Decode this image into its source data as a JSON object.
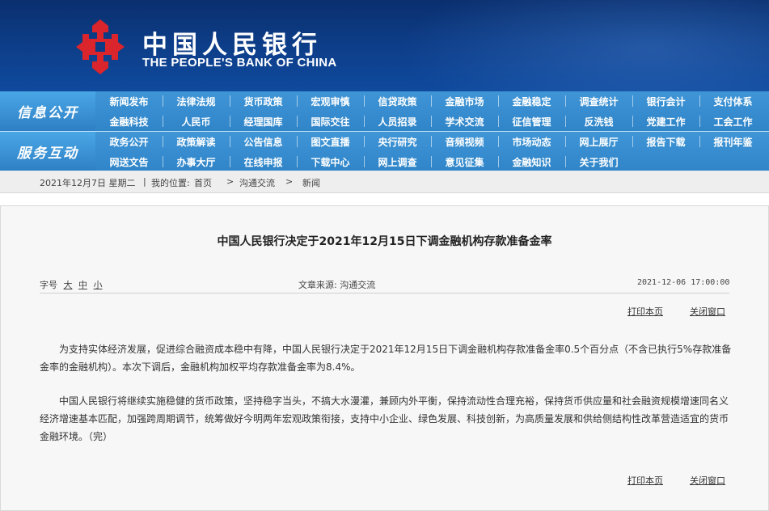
{
  "header": {
    "logo_cn": "中国人民银行",
    "logo_en": "THE PEOPLE'S BANK OF CHINA"
  },
  "colors": {
    "header_bg": "#0d3c86",
    "nav_bg": "#3b8fd0",
    "logo_red": "#d9252b"
  },
  "nav": {
    "group1_label": "信息公开",
    "group1_items": [
      "新闻发布",
      "法律法规",
      "货币政策",
      "宏观审慎",
      "信贷政策",
      "金融市场",
      "金融稳定",
      "调查统计",
      "银行会计",
      "支付体系",
      "金融科技",
      "人民币",
      "经理国库",
      "国际交往",
      "人员招录",
      "学术交流",
      "征信管理",
      "反洗钱",
      "党建工作",
      "工会工作"
    ],
    "group2_label": "服务互动",
    "group2_items": [
      "政务公开",
      "政策解读",
      "公告信息",
      "图文直播",
      "央行研究",
      "音频视频",
      "市场动态",
      "网上展厅",
      "报告下载",
      "报刊年鉴",
      "网送文告",
      "办事大厅",
      "在线申报",
      "下载中心",
      "网上调查",
      "意见征集",
      "金融知识",
      "关于我们"
    ]
  },
  "breadcrumb": {
    "date": "2021年12月7日 星期二",
    "sep": "|",
    "location_label": "我的位置:",
    "home": "首页",
    "arrow1": ">",
    "section": "沟通交流",
    "arrow2": ">",
    "page": "新闻"
  },
  "article": {
    "title": "中国人民银行决定于2021年12月15日下调金融机构存款准备金率",
    "font_size_label": "字号",
    "font_large": "大",
    "font_medium": "中",
    "font_small": "小",
    "source": "文章来源: 沟通交流",
    "datetime": "2021-12-06 17:00:00",
    "print_label": "打印本页",
    "close_label": "关闭窗口",
    "paragraph1": "为支持实体经济发展，促进综合融资成本稳中有降，中国人民银行决定于2021年12月15日下调金融机构存款准备金率0.5个百分点（不含已执行5%存款准备金率的金融机构）。本次下调后，金融机构加权平均存款准备金率为8.4%。",
    "paragraph2": "中国人民银行将继续实施稳健的货币政策，坚持稳字当头，不搞大水漫灌，兼顾内外平衡，保持流动性合理充裕，保持货币供应量和社会融资规模增速同名义经济增速基本匹配，加强跨周期调节，统筹做好今明两年宏观政策衔接，支持中小企业、绿色发展、科技创新，为高质量发展和供给侧结构性改革营造适宜的货币金融环境。（完）"
  }
}
